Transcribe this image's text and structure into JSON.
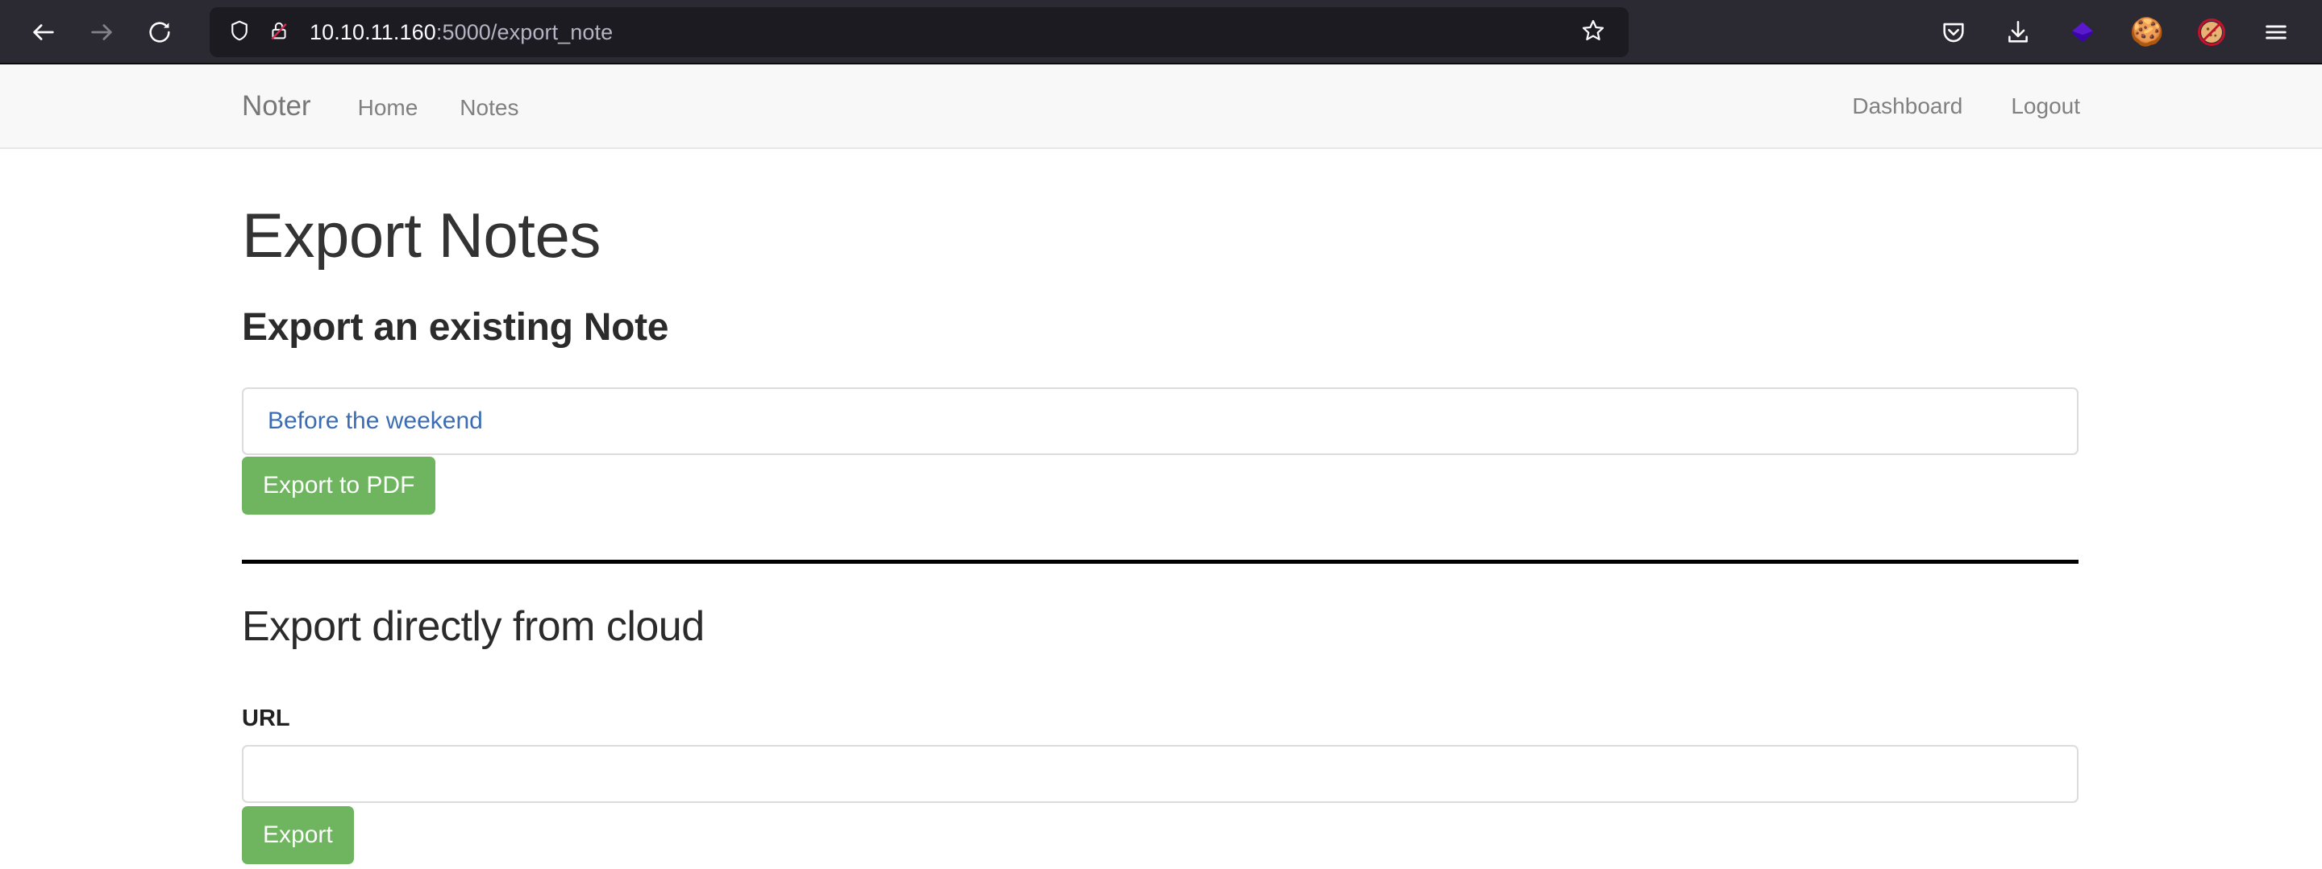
{
  "browser": {
    "back_icon": "back-arrow-icon",
    "forward_icon": "forward-arrow-icon",
    "reload_icon": "reload-icon",
    "shield_icon": "tracking-protection-shield-icon",
    "lock_icon": "insecure-connection-lock-icon",
    "url_host": "10.10.11.160",
    "url_rest": ":5000/export_note",
    "bookmark_icon": "bookmark-star-icon",
    "extensions": [
      {
        "name": "pocket-icon",
        "glyph": "pocket"
      },
      {
        "name": "downloads-icon",
        "glyph": "download"
      },
      {
        "name": "purple-diamond-extension-icon",
        "glyph": "diamond"
      },
      {
        "name": "cookie-extension-icon",
        "glyph": "🍪"
      },
      {
        "name": "cookie-blocker-extension-icon",
        "glyph": "🚫🦊"
      },
      {
        "name": "application-menu-icon",
        "glyph": "hamburger"
      }
    ],
    "chrome_bg": "#2b2a33",
    "urlbar_bg": "#1c1b22"
  },
  "navbar": {
    "brand": "Noter",
    "left_links": [
      {
        "label": "Home"
      },
      {
        "label": "Notes"
      }
    ],
    "right_links": [
      {
        "label": "Dashboard"
      },
      {
        "label": "Logout"
      }
    ],
    "bg": "#f8f8f8"
  },
  "main": {
    "page_title": "Export Notes",
    "section_one": {
      "heading": "Export an existing Note",
      "selected_note": "Before the weekend",
      "submit_label": "Export to PDF"
    },
    "section_two": {
      "heading": "Export directly from cloud",
      "url_label": "URL",
      "url_value": "",
      "url_placeholder": "",
      "submit_label": "Export"
    }
  },
  "colors": {
    "button_green": "#6fb560",
    "link_blue": "#3b6db5",
    "divider_black": "#000000"
  }
}
